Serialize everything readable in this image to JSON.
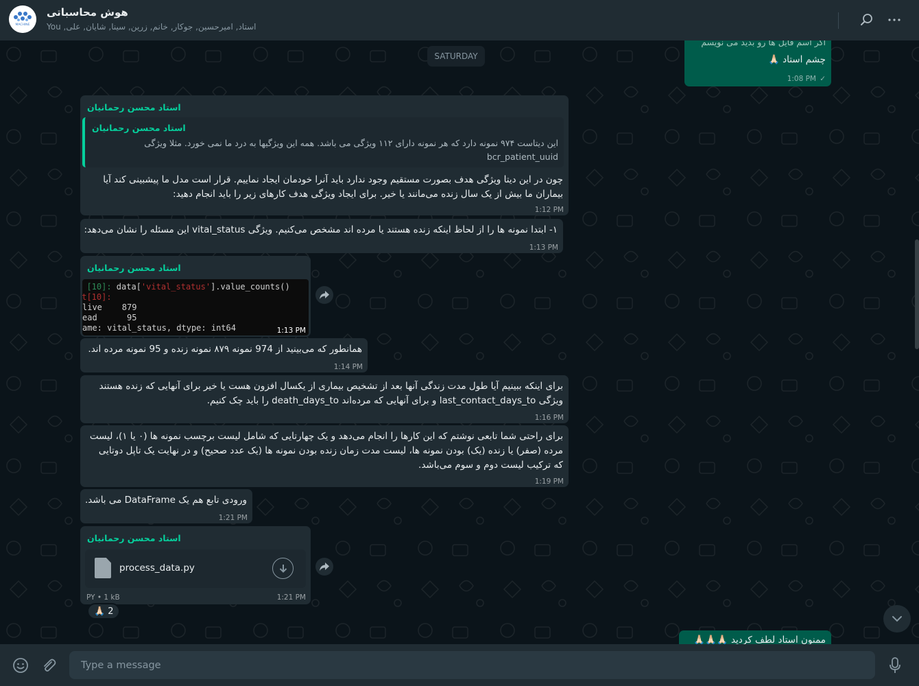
{
  "header": {
    "group_name": "هوش محاسباتی",
    "members": "You ,استاد, امیرحسین, جوکار, خانم, زرین, سینا, شایان, علی",
    "avatar_text": "MACHINE"
  },
  "chat": {
    "date_chip": "SATURDAY",
    "top_out": {
      "cut_text": "اگر اسم فایل ها رو بدید می نویسم",
      "text": "چشم استاد 🙏🏻",
      "time": "1:08 PM",
      "status": "✓"
    },
    "messages": [
      {
        "sender": "استاد محسن رحمانیان",
        "quote_sender": "استاد محسن رحمانیان",
        "quote_text": "این دیتاست ۹۷۴ نمونه دارد که هر نمونه دارای ۱۱۲ ویژگی می باشد. همه این ویژگیها به درد ما نمی خورد. مثلا ویژگی bcr_patient_uuid",
        "text": "چون در این دیتا ویژگی هدف بصورت مستقیم وجود ندارد باید آنرا خودمان ایجاد نماییم. قرار است مدل ما پیشبینی کند آیا بیماران ما بیش از یک سال زنده می‌مانند یا خیر. برای ایجاد ویژگی هدف کارهای زیر را باید انجام دهید:",
        "time": "1:12 PM"
      },
      {
        "text": "۱- ابتدا نمونه ها را از لحاظ اینکه زنده هستند یا مرده اند مشخص می‌کنیم. ویژگی vital_status این مسئله را نشان می‌دهد:",
        "time": "1:13 PM"
      },
      {
        "sender": "استاد محسن رحمانیان",
        "code_lines": [
          {
            "prompt": "n [10]: ",
            "code": "data[",
            "str": "'vital_status'",
            "rest": "].value_counts()"
          },
          {
            "prompt": "ut[10]:",
            "code": "",
            "str": "",
            "rest": ""
          },
          {
            "prompt": "",
            "code": "live    879",
            "str": "",
            "rest": ""
          },
          {
            "prompt": "",
            "code": "ead      95",
            "str": "",
            "rest": ""
          },
          {
            "prompt": "",
            "code": "ame: vital_status, dtype: int64",
            "str": "",
            "rest": ""
          }
        ],
        "time": "1:13 PM"
      },
      {
        "text": "همانطور که می‌بینید از 974 نمونه ۸۷۹ نمونه زنده و 95 نمونه مرده اند.",
        "time": "1:14 PM"
      },
      {
        "text": "برای اینکه ببینیم آیا طول مدت زندگی آنها بعد از تشخیص بیماری از یکسال افزون هست یا خیر برای آنهایی که زنده هستند ویژگی last_contact_days_to و برای آنهایی که مرده‌اند death_days_to را باید چک کنیم.",
        "time": "1:16 PM"
      },
      {
        "text": "برای راحتی شما تابعی نوشتم که این کارها را انجام می‌دهد و یک چهارتایی که شامل لیست برچسب نمونه ها (۰ یا ۱)، لیست مرده (صفر) یا زنده (یک) بودن نمونه ها، لیست مدت زمان زنده بودن نمونه ها (یک عدد صحیح) و در نهایت یک تاپل دوتایی که ترکیب لیست دوم و سوم می‌باشد.",
        "time": "1:19 PM"
      },
      {
        "text": "ورودی تابع هم یک DataFrame می باشد.",
        "time": "1:21 PM"
      },
      {
        "sender": "استاد محسن رحمانیان",
        "file_name": "process_data.py",
        "file_meta": "PY • 1 kB",
        "time": "1:21 PM",
        "reaction": "🙏🏻",
        "reaction_count": "2"
      }
    ],
    "bottom_out": "ممنون استاد لطف کردید 🙏🏻🙏🏻🙏🏻"
  },
  "footer": {
    "placeholder": "Type a message"
  }
}
